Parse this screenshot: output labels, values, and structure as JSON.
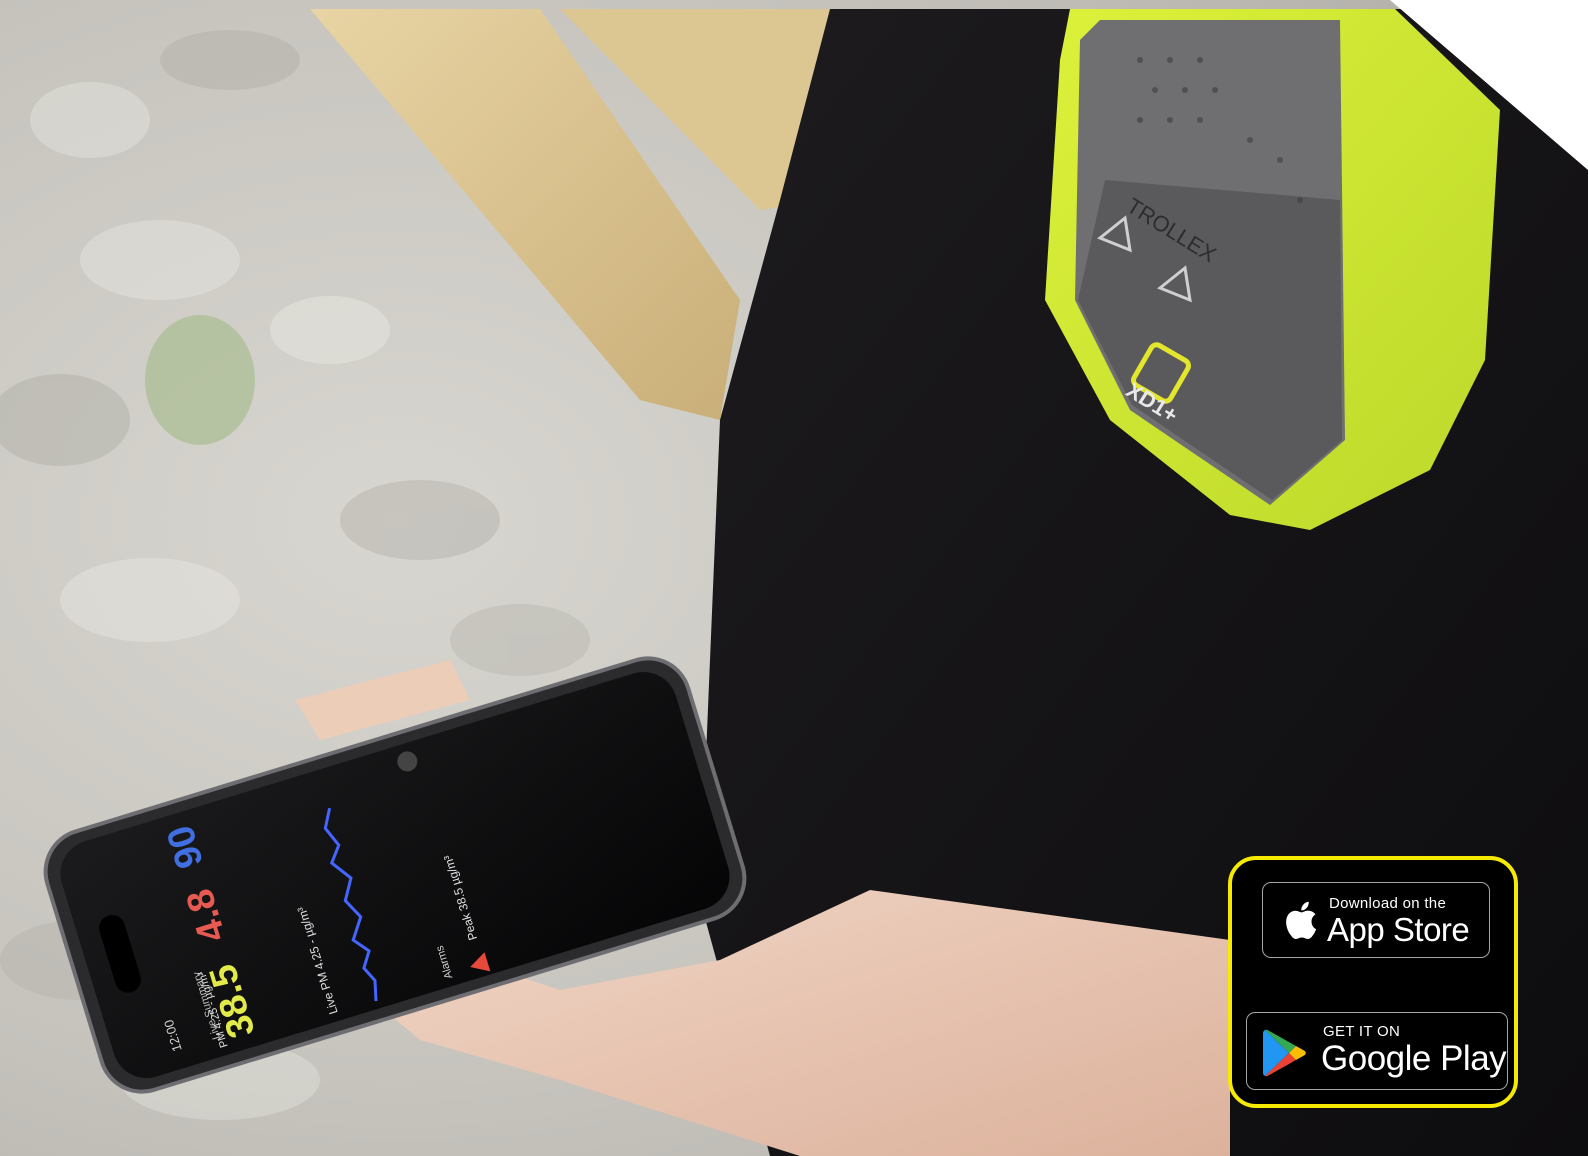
{
  "scene": {
    "device": {
      "brand_text": "TROLLEX",
      "model_text": "XD1+"
    },
    "phone_app": {
      "time": "12:00",
      "header_title": "Live Summary",
      "readings": [
        {
          "label": "PM 4.25 - µg/m³",
          "value": "38.5",
          "color": "#e2e94a"
        },
        {
          "label": "",
          "value": "4.8",
          "color": "#e65a52"
        },
        {
          "label": "",
          "value": "90",
          "color": "#3f6fe0"
        }
      ],
      "chart_title": "Live PM 4.25 - µg/m³",
      "alarms_label": "Alarms",
      "alarm_text": "Peak 38.5 µg/m³",
      "accent_colors": {
        "chart_line": "#4466ff",
        "alarm": "#e64a3c"
      }
    }
  },
  "store_badges": {
    "frame_color": "#f5ea00",
    "app_store": {
      "small_text": "Download on the",
      "large_text": "App Store",
      "icon": "apple-icon"
    },
    "google_play": {
      "small_text": "GET IT ON",
      "large_text": "Google Play",
      "icon": "google-play-icon"
    }
  }
}
